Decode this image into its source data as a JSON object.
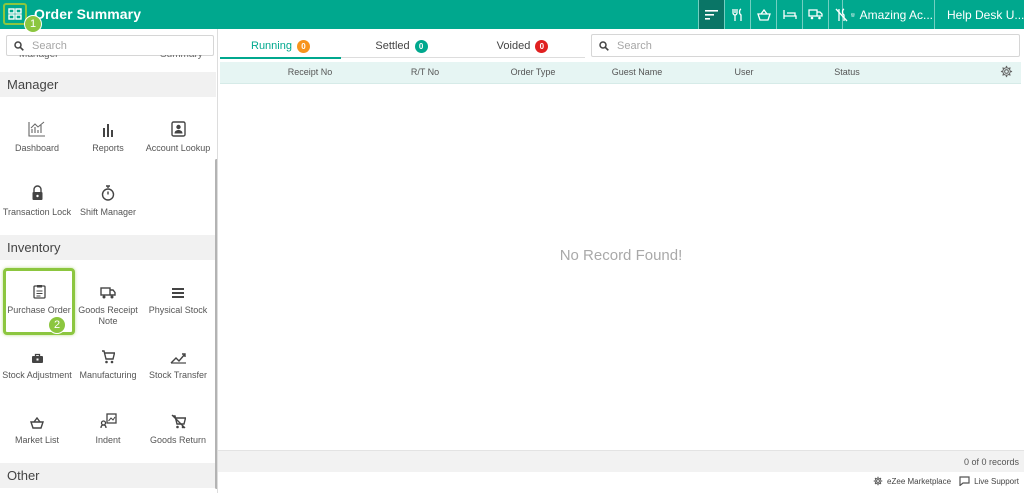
{
  "header": {
    "title": "Order Summary",
    "outlet": "Amazing Ac...",
    "user": "Help Desk U..."
  },
  "steps": [
    "1",
    "2"
  ],
  "sidebar": {
    "search_placeholder": "Search",
    "cut_labels": [
      "Manager",
      "Summary"
    ],
    "sections": [
      {
        "title": "Manager",
        "items": [
          {
            "label": "Dashboard",
            "icon": "dashboard-chart-icon"
          },
          {
            "label": "Reports",
            "icon": "bar-chart-icon"
          },
          {
            "label": "Account Lookup",
            "icon": "account-card-icon"
          },
          {
            "label": "Transaction Lock",
            "icon": "lock-icon"
          },
          {
            "label": "Shift Manager",
            "icon": "stopwatch-icon"
          }
        ]
      },
      {
        "title": "Inventory",
        "items": [
          {
            "label": "Purchase Order",
            "icon": "clipboard-icon"
          },
          {
            "label": "Goods Receipt Note",
            "icon": "truck-icon"
          },
          {
            "label": "Physical Stock",
            "icon": "list-icon"
          },
          {
            "label": "Stock Adjustment",
            "icon": "toolbox-icon"
          },
          {
            "label": "Manufacturing",
            "icon": "cart-icon"
          },
          {
            "label": "Stock Transfer",
            "icon": "transfer-icon"
          },
          {
            "label": "Market List",
            "icon": "basket-icon"
          },
          {
            "label": "Indent",
            "icon": "indent-icon"
          },
          {
            "label": "Goods Return",
            "icon": "cart-cancel-icon"
          }
        ]
      },
      {
        "title": "Other",
        "items": []
      }
    ]
  },
  "tabs": [
    {
      "label": "Running",
      "count": "0",
      "color": "#f7941d"
    },
    {
      "label": "Settled",
      "count": "0",
      "color": "#00a88e"
    },
    {
      "label": "Voided",
      "count": "0",
      "color": "#e02020"
    }
  ],
  "main_search_placeholder": "Search",
  "table": {
    "columns": [
      "Receipt No",
      "R/T No",
      "Order Type",
      "Guest Name",
      "User",
      "Status"
    ],
    "empty_message": "No Record Found!"
  },
  "footer": {
    "records": "0 of 0 records",
    "marketplace": "eZee Marketplace",
    "support": "Live Support"
  },
  "colors": {
    "brand": "#00a88e",
    "highlight": "#8cc63f"
  }
}
